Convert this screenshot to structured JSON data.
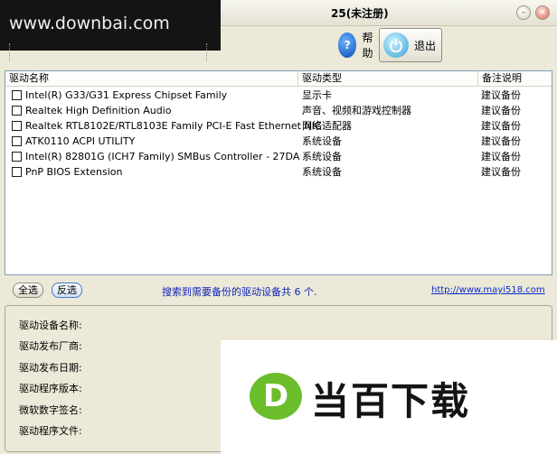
{
  "window": {
    "title_partial": "25(未注册)",
    "minimize_glyph": "–",
    "close_glyph": "×"
  },
  "watermark_top": "www.downbai.com",
  "toolbar": {
    "help_label": "帮助",
    "exit_label": "退出",
    "help_icon": "help-icon",
    "exit_icon": "power-icon"
  },
  "table": {
    "headers": [
      "驱动名称",
      "驱动类型",
      "备注说明"
    ],
    "rows": [
      {
        "name": "Intel(R) G33/G31 Express Chipset Family",
        "type": "显示卡",
        "note": "建议备份",
        "checked": false
      },
      {
        "name": "Realtek High Definition Audio",
        "type": "声音、视频和游戏控制器",
        "note": "建议备份",
        "checked": false
      },
      {
        "name": "Realtek RTL8102E/RTL8103E Family PCI-E Fast Ethernet NIC",
        "type": "网络适配器",
        "note": "建议备份",
        "checked": false
      },
      {
        "name": "ATK0110 ACPI UTILITY",
        "type": "系统设备",
        "note": "建议备份",
        "checked": false
      },
      {
        "name": "Intel(R) 82801G (ICH7 Family) SMBus Controller - 27DA",
        "type": "系统设备",
        "note": "建议备份",
        "checked": false
      },
      {
        "name": "PnP BIOS Extension",
        "type": "系统设备",
        "note": "建议备份",
        "checked": false
      }
    ]
  },
  "actions": {
    "select_all": "全选",
    "invert": "反选"
  },
  "status_text": "搜索到需要备份的驱动设备共 6 个.",
  "website": "http://www.mayi518.com",
  "details": {
    "labels": [
      "驱动设备名称:",
      "驱动发布厂商:",
      "驱动发布日期:",
      "驱动程序版本:",
      "微软数字签名:",
      "驱动程序文件:"
    ]
  },
  "watermark_br": {
    "logo_letter": "D",
    "text": "当百下载"
  },
  "colors": {
    "window_bg": "#ece9d8",
    "status_text": "#0f22b8",
    "logo_green": "#6bbd2c"
  }
}
